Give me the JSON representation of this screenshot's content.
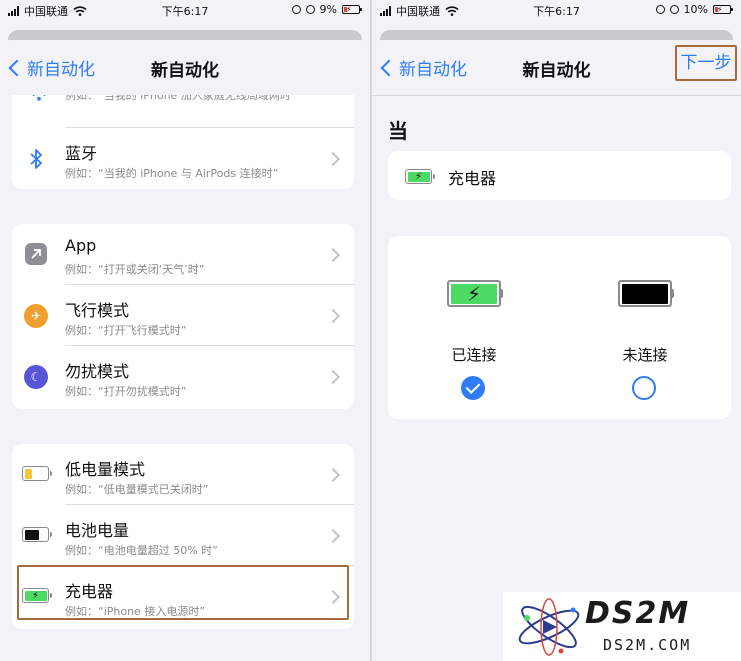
{
  "left": {
    "status": {
      "carrier": "中国联通",
      "time": "下午6:17",
      "battery": "9%"
    },
    "nav": {
      "back": "新自动化",
      "title": "新自动化"
    },
    "groups": [
      [
        {
          "key": "wifi",
          "title": "",
          "subtitle": "例如：“当我的 iPhone 加入家庭无线局域网时”",
          "icon": "wifi-icon",
          "cut": true
        },
        {
          "key": "bluetooth",
          "title": "蓝牙",
          "subtitle": "例如：“当我的 iPhone 与 AirPods 连接时”",
          "icon": "bluetooth-icon"
        }
      ],
      [
        {
          "key": "app",
          "title": "App",
          "subtitle": "例如：“打开或关闭‘天气’时”",
          "icon": "app-arrow-icon"
        },
        {
          "key": "airplane",
          "title": "飞行模式",
          "subtitle": "例如：“打开飞行模式时”",
          "icon": "airplane-icon"
        },
        {
          "key": "dnd",
          "title": "勿扰模式",
          "subtitle": "例如：“打开勿扰模式时”",
          "icon": "moon-icon"
        }
      ],
      [
        {
          "key": "low-power",
          "title": "低电量模式",
          "subtitle": "例如：“低电量模式已关闭时”",
          "icon": "low-battery-icon"
        },
        {
          "key": "battery-level",
          "title": "电池电量",
          "subtitle": "例如：“电池电量超过 50% 时”",
          "icon": "battery-icon"
        },
        {
          "key": "charger",
          "title": "充电器",
          "subtitle": "例如：“iPhone 接入电源时”",
          "icon": "charging-battery-icon"
        }
      ]
    ]
  },
  "right": {
    "status": {
      "carrier": "中国联通",
      "time": "下午6:17",
      "battery": "10%"
    },
    "nav": {
      "back": "新自动化",
      "title": "新自动化",
      "next": "下一步"
    },
    "section": "当",
    "trigger": "充电器",
    "options": [
      {
        "label": "已连接",
        "selected": true
      },
      {
        "label": "未连接",
        "selected": false
      }
    ]
  },
  "watermark": {
    "brand": "DS2M",
    "url": "DS2M.COM"
  },
  "colors": {
    "accent": "#2f7cf6",
    "highlight": "#a56a3e",
    "charging_green": "#4cd964",
    "low_power_yellow": "#f5c542",
    "airplane_orange": "#f0a030",
    "dnd_purple": "#5856d6",
    "app_gray": "#8e8e93"
  }
}
